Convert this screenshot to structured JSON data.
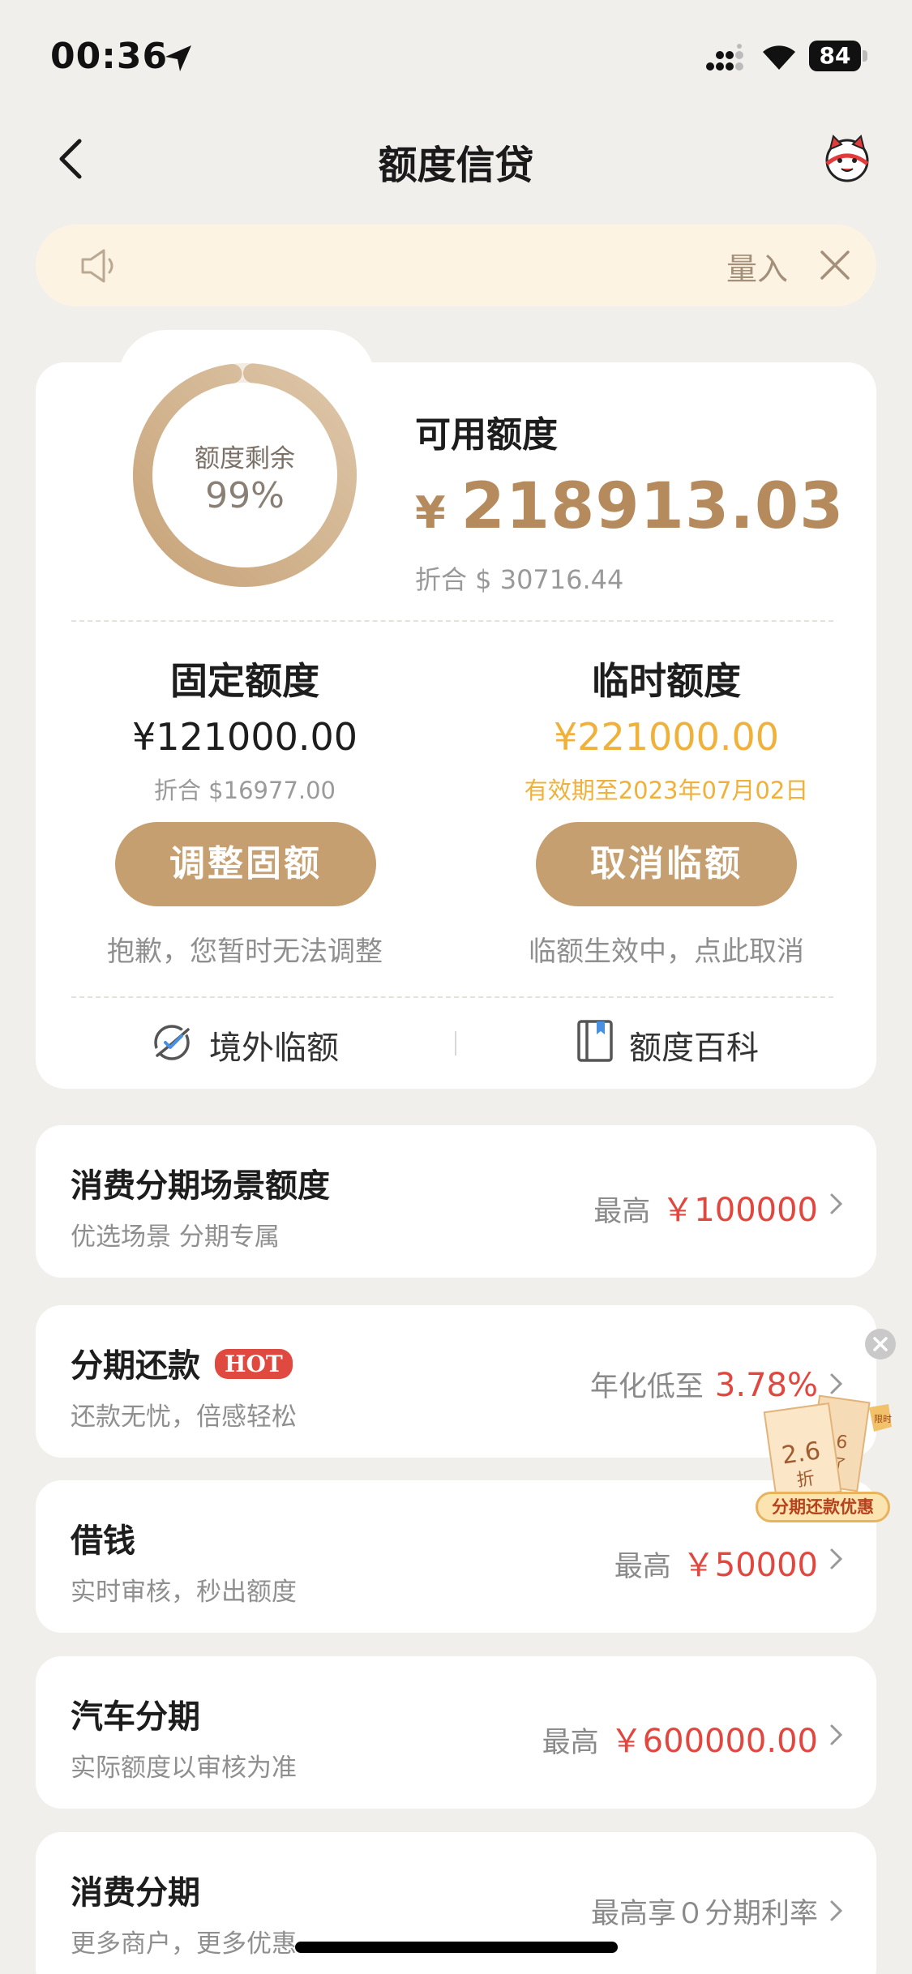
{
  "status_bar": {
    "time": "00:36",
    "battery": "84"
  },
  "nav": {
    "title": "额度信贷"
  },
  "notice": {
    "text": "量入"
  },
  "credit": {
    "ring_label": "额度剩余",
    "ring_percent": "99%",
    "ring_fraction": 0.99,
    "available_title": "可用额度",
    "available_currency": "¥",
    "available_amount": "218913.03",
    "available_usd": "折合 $ 30716.44"
  },
  "fixed": {
    "title": "固定额度",
    "amount": "¥121000.00",
    "usd": "折合 $16977.00",
    "button": "调整固额",
    "note": "抱歉，您暂时无法调整"
  },
  "temporary": {
    "title": "临时额度",
    "amount": "¥221000.00",
    "validity": "有效期至2023年07月02日",
    "button": "取消临额",
    "note": "临额生效中，点此取消"
  },
  "links": {
    "overseas": "境外临额",
    "wiki": "额度百科"
  },
  "list": [
    {
      "title": "消费分期场景额度",
      "sub": "优选场景 分期专属",
      "prefix": "最高",
      "value": "￥100000"
    },
    {
      "title": "分期还款",
      "badge": "HOT",
      "sub": "还款无忧，倍感轻松",
      "prefix": "年化低至",
      "value": "3.78%"
    },
    {
      "title": "借钱",
      "sub": "实时审核，秒出额度",
      "prefix": "最高",
      "value": "￥50000"
    },
    {
      "title": "汽车分期",
      "sub": "实际额度以审核为准",
      "prefix": "最高",
      "value": "￥600000.00"
    },
    {
      "title": "消费分期",
      "sub": "更多商户，更多优惠",
      "prefix": "最高享０分期利率",
      "value": ""
    }
  ],
  "promo": {
    "discount": "2.6",
    "discount_unit": "折",
    "back_number": "6",
    "back_unit": "了",
    "tag": "限时",
    "label": "分期还款优惠"
  },
  "colors": {
    "accent_gold": "#c69f70",
    "amount_gold": "#b58a5c",
    "temp_yellow": "#efb139",
    "red_value": "#e2473f",
    "background": "#f1efec"
  },
  "icons": [
    "location-arrow-icon",
    "signal-icon",
    "wifi-icon",
    "battery-icon",
    "back-chevron-icon",
    "mascot-avatar-icon",
    "speaker-icon",
    "close-icon",
    "overseas-icon",
    "book-icon",
    "chevron-right-icon"
  ]
}
